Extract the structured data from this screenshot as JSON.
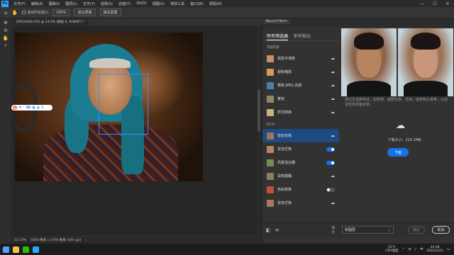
{
  "menubar": {
    "logo": "Ps",
    "items": [
      "文件(F)",
      "编辑(E)",
      "图像(I)",
      "图层(L)",
      "文字(Y)",
      "选择(S)",
      "滤镜(T)",
      "3D(D)",
      "视图(V)",
      "增效工具",
      "窗口(W)",
      "帮助(H)"
    ],
    "window_controls": [
      "—",
      "☐",
      "✕"
    ]
  },
  "options_bar": {
    "scroll_all_label": "滚动所有窗口",
    "zoom_value": "100%",
    "fit_screen_label": "适合屏幕",
    "fill_screen_label": "填充屏幕"
  },
  "document": {
    "tab_title": "ZXFL0400.CR2 @ 33.3% (图层 0, RGB/8*) *",
    "status_zoom": "33.33%",
    "status_info": "5456 像素 x 3708 像素 (300 ppi)"
  },
  "ime_toolbar": {
    "logo": "S",
    "items": [
      "中",
      "°",
      "⌨",
      "▦",
      "▤",
      "☰"
    ]
  },
  "neural_filters": {
    "panel_title": "Neural Filters",
    "tabs": [
      "所有筛选器",
      "即将推出"
    ],
    "section_featured": "专题内容",
    "section_beta": "BETA",
    "featured": [
      {
        "name": "皮肤平滑度",
        "color": "#c8906a"
      },
      {
        "name": "超级缩放",
        "color": "#d49a5c"
      },
      {
        "name": "移除 JPEG 伪影",
        "color": "#4a7fb0"
      },
      {
        "name": "着色",
        "color": "#8a8a6a"
      },
      {
        "name": "样式转换",
        "color": "#c9b27a"
      }
    ],
    "beta": [
      {
        "name": "智能肖像",
        "color": "#9a7460",
        "state": "download",
        "active": true
      },
      {
        "name": "妆容迁移",
        "color": "#b58466",
        "state": "toggle-on",
        "active": false
      },
      {
        "name": "风景混合器",
        "color": "#6f8f5a",
        "state": "toggle-on",
        "active": false
      },
      {
        "name": "深度模糊",
        "color": "#8a7a6a",
        "state": "download",
        "active": false
      },
      {
        "name": "色彩转移",
        "color": "#c0503a",
        "state": "toggle-off",
        "active": false
      },
      {
        "name": "妆容迁移",
        "color": "#a87860",
        "state": "download",
        "active": false
      }
    ],
    "description": "通过生成新特征，如表情、面部年龄、光线、姿势和头发等，以创造性地调整肖像。",
    "download_size": "下载大小：215.1MB",
    "download_button": "下载",
    "output_label": "输出",
    "output_value": "新图层",
    "ok_button": "确定",
    "cancel_button": "取消"
  },
  "taskbar": {
    "weather_temp": "53°C",
    "weather_label": "CPU温度",
    "lang": "中",
    "time": "22:40",
    "date": "2022/1/21",
    "icons": [
      {
        "name": "start-icon",
        "color": "#4fa3ff"
      },
      {
        "name": "file-explorer-icon",
        "color": "#f2c14e"
      },
      {
        "name": "wechat-icon",
        "color": "#2dc100"
      },
      {
        "name": "photoshop-icon",
        "color": "#31a8ff"
      }
    ]
  },
  "colors": {
    "accent": "#1473e6",
    "panel_bg": "#323232",
    "selection_box": "#3d8bff"
  }
}
